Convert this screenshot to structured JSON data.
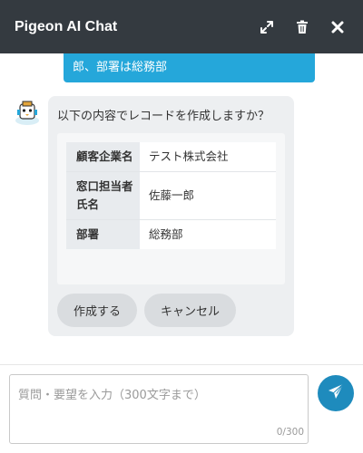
{
  "header": {
    "title": "Pigeon AI Chat",
    "icons": [
      "expand-icon",
      "trash-icon",
      "close-icon"
    ]
  },
  "messages": {
    "user_message_fragment": "郎、部署は総務部",
    "bot": {
      "prompt": "以下の内容でレコードを作成しますか？",
      "record": [
        {
          "key": "顧客企業名",
          "value": "テスト株式会社"
        },
        {
          "key": "窓口担当者氏名",
          "value": "佐藤一郎"
        },
        {
          "key": "部署",
          "value": "総務部"
        }
      ],
      "buttons": {
        "create": "作成する",
        "cancel": "キャンセル"
      }
    }
  },
  "composer": {
    "placeholder": "質問・要望を入力（300文字まで）",
    "value": "",
    "counter": "0/300"
  },
  "colors": {
    "header_bg": "#343a40",
    "user_bubble": "#25a7da",
    "send_button": "#1e8bbd"
  }
}
